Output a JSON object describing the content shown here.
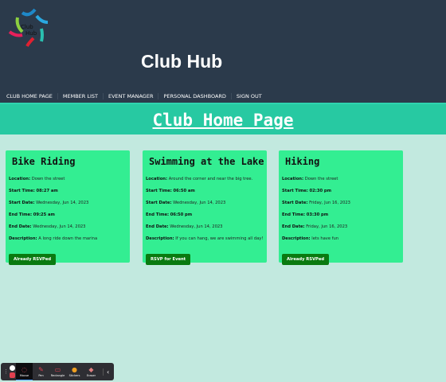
{
  "header": {
    "title": "Club Hub",
    "logo_text": "Club Hub"
  },
  "nav": [
    "CLUB HOME PAGE",
    "MEMBER LIST",
    "EVENT MANAGER",
    "PERSONAL DASHBOARD",
    "SIGN OUT"
  ],
  "page_title": "Club Home Page",
  "labels": {
    "location": "Location:",
    "start_time": "Start Time:",
    "start_date": "Start Date:",
    "end_time": "End Time:",
    "end_date": "End Date:",
    "description": "Description:"
  },
  "events": [
    {
      "title": "Bike Riding",
      "location": "Down the street",
      "start_time": "08:27 am",
      "start_date": "Wednesday, Jun 14, 2023",
      "end_time": "09:25 am",
      "end_date": "Wednesday, Jun 14, 2023",
      "description": "A long ride down the marina",
      "button": "Already RSVPed"
    },
    {
      "title": "Swimming at the Lake",
      "location": "Around the corner and near the big tree.",
      "start_time": "06:50 am",
      "start_date": "Wednesday, Jun 14, 2023",
      "end_time": "06:50 pm",
      "end_date": "Wednesday, Jun 14, 2023",
      "description": "If you can hang, we are swimming all day!",
      "button": "RSVP for Event"
    },
    {
      "title": "Hiking",
      "location": "Down the street",
      "start_time": "02:30 pm",
      "start_date": "Friday, Jun 16, 2023",
      "end_time": "03:30 pm",
      "end_date": "Friday, Jun 16, 2023",
      "description": "lets have fun",
      "button": "Already RSVPed"
    }
  ],
  "toolbar": [
    "Mouse",
    "Pen",
    "Rectangle",
    "Stickers",
    "Eraser"
  ]
}
